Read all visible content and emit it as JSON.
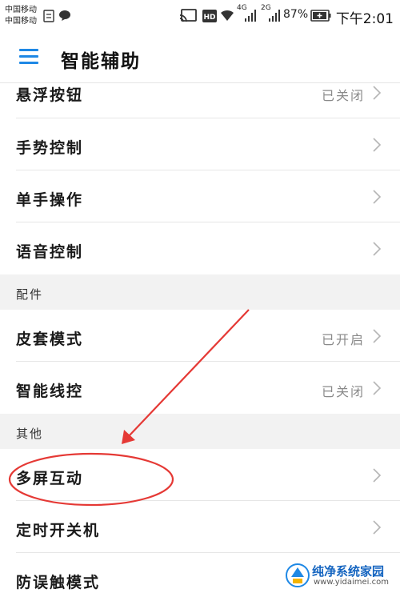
{
  "status_bar": {
    "carrier_1": "中国移动",
    "carrier_2": "中国移动",
    "network_1": "4G",
    "network_2": "2G",
    "battery": "87%",
    "time": "下午2:01",
    "icons": [
      "dual-sim-icon",
      "message-icon",
      "cast-icon",
      "hd-icon",
      "wifi-icon",
      "signal-icon",
      "battery-icon"
    ]
  },
  "app_bar": {
    "title": "智能辅助",
    "menu_icon": "hamburger-menu-icon",
    "accent_color": "#1e88e5"
  },
  "list": {
    "floating_button": {
      "label": "悬浮按钮",
      "value": "已关闭"
    },
    "gesture_control": {
      "label": "手势控制"
    },
    "one_hand": {
      "label": "单手操作"
    },
    "voice_control": {
      "label": "语音控制"
    },
    "section_accessories": "配件",
    "cover_mode": {
      "label": "皮套模式",
      "value": "已开启"
    },
    "smart_remote": {
      "label": "智能线控",
      "value": "已关闭"
    },
    "section_other": "其他",
    "multi_screen": {
      "label": "多屏互动"
    },
    "scheduled_power": {
      "label": "定时开关机"
    },
    "mistouch": {
      "label": "防误触模式"
    }
  },
  "annotation": {
    "color": "#e53935",
    "type": "red-arrow-and-ellipse"
  },
  "watermark": {
    "text": "纯净系统家园",
    "url": "www.yidaimei.com"
  }
}
